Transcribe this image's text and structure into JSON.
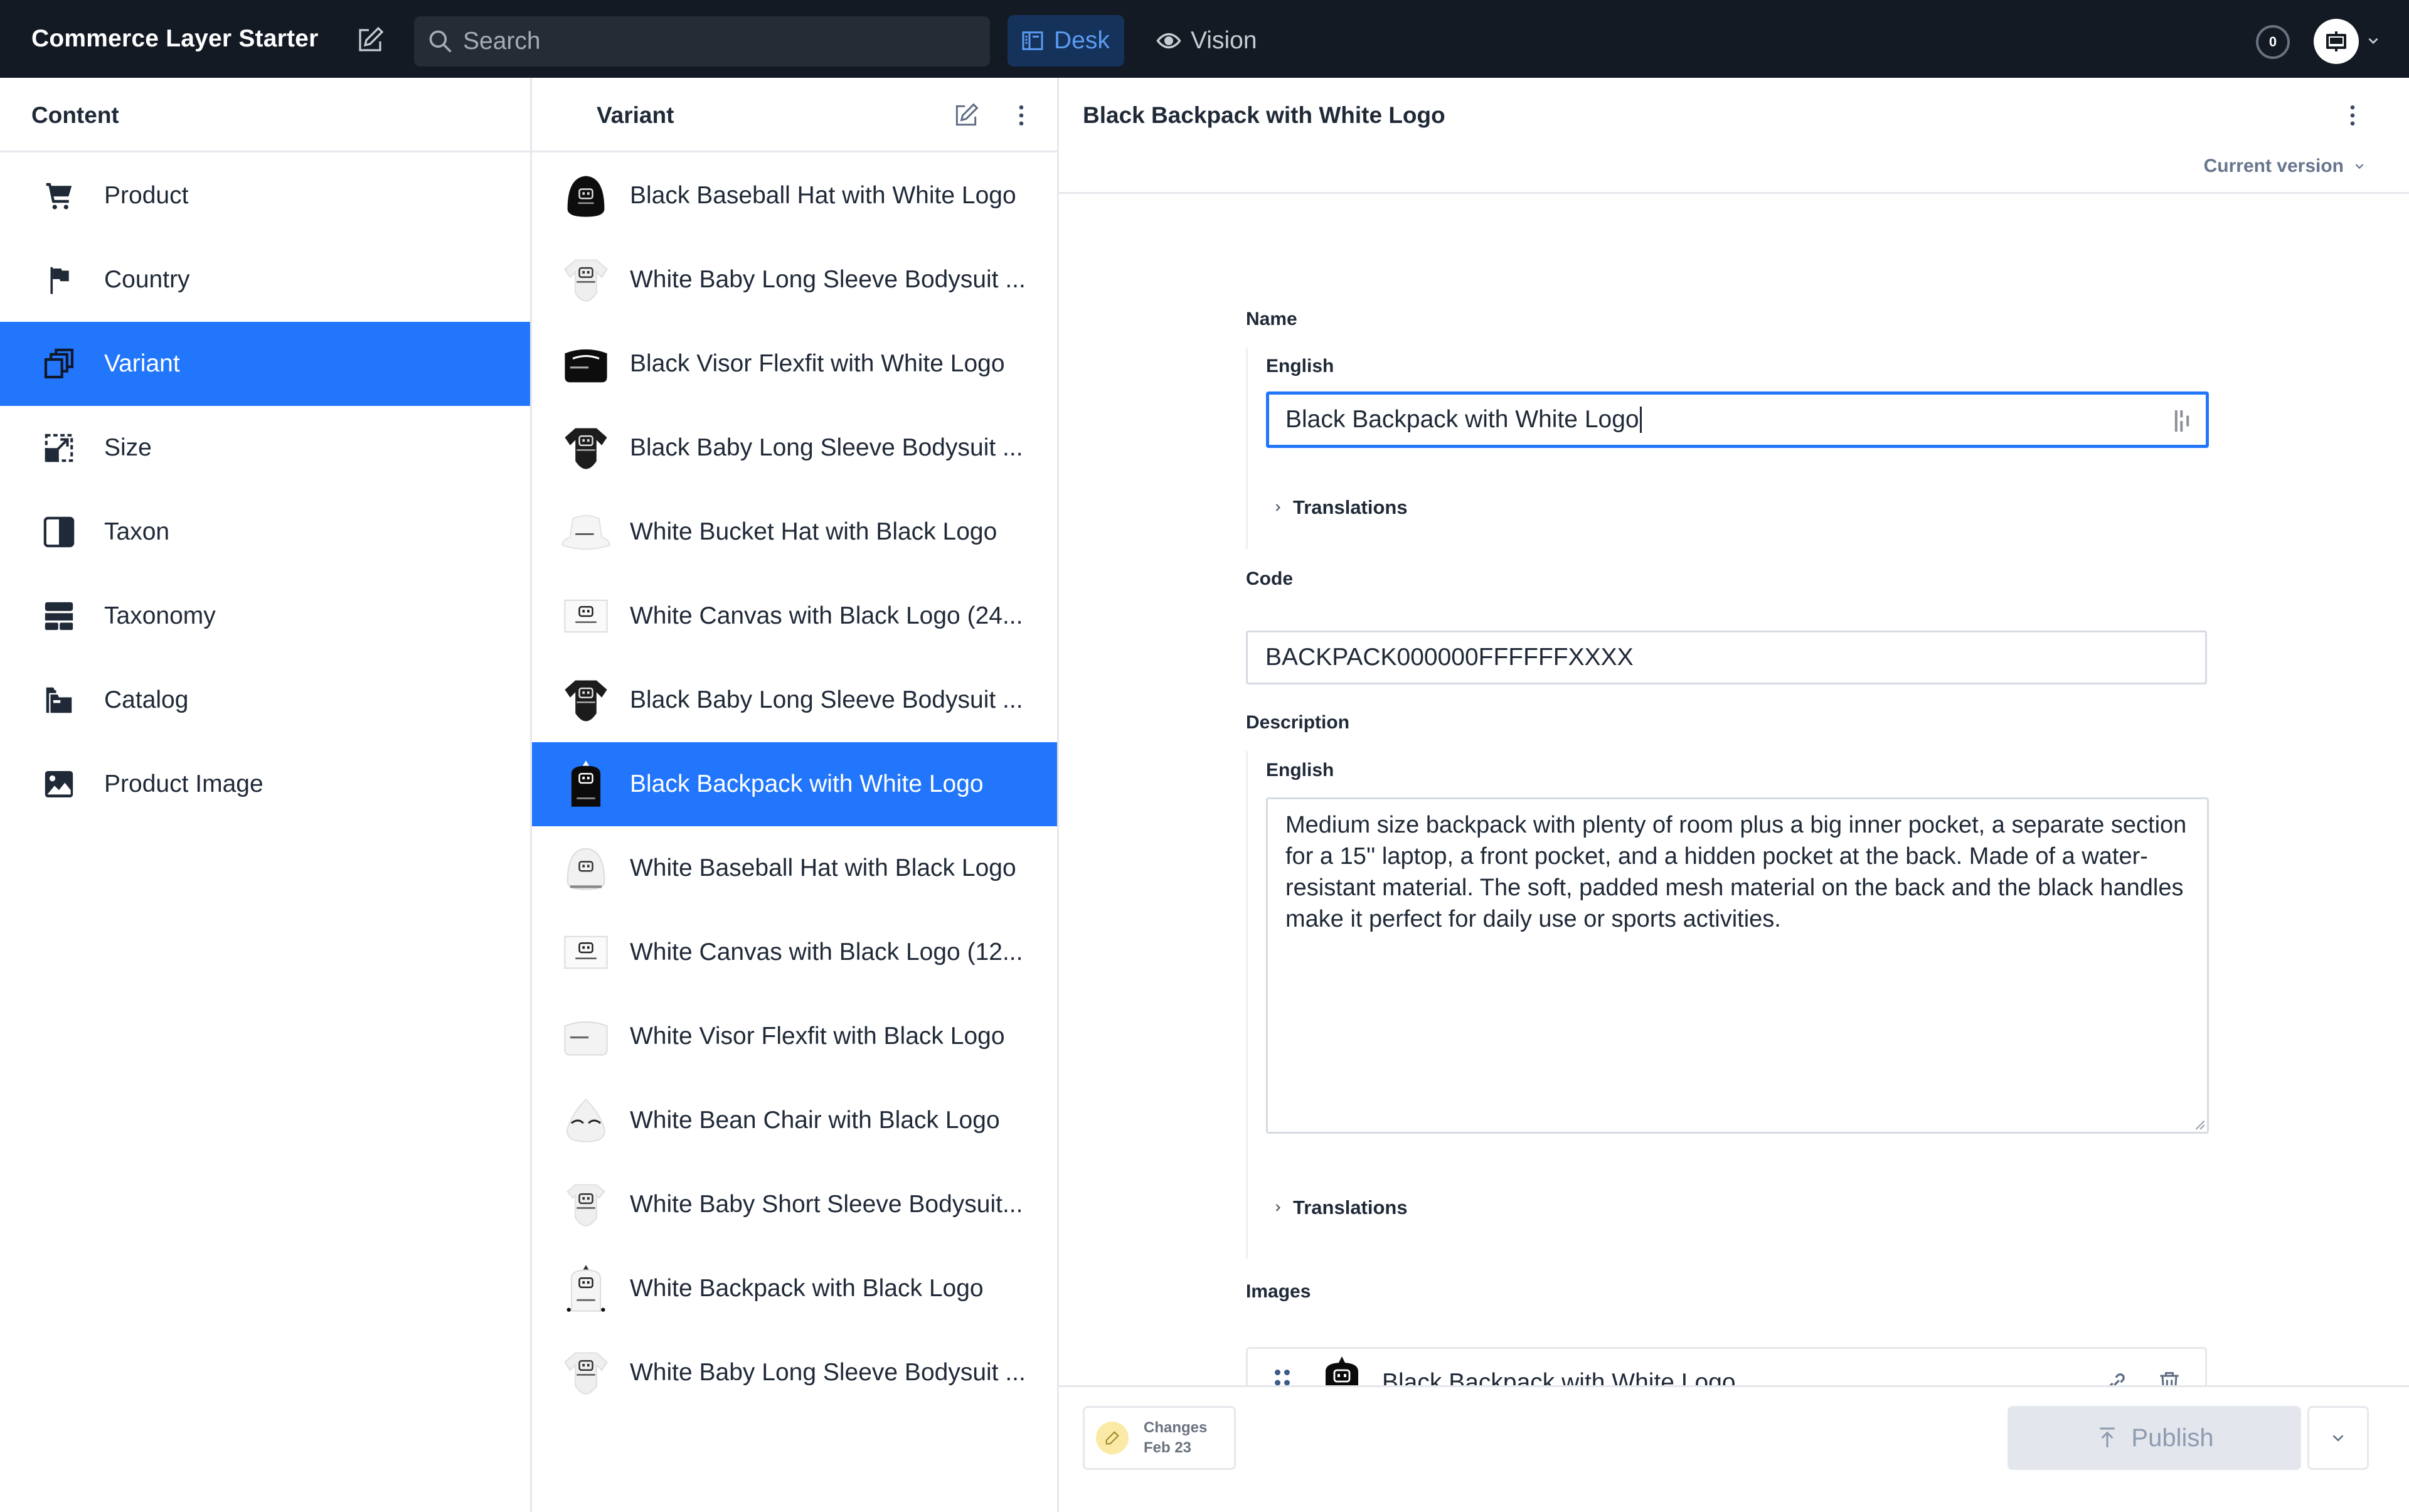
{
  "topbar": {
    "brand": "Commerce Layer Starter",
    "search_placeholder": "Search",
    "tools": [
      {
        "label": "Desk",
        "icon": "desk-icon",
        "active": true
      },
      {
        "label": "Vision",
        "icon": "eye-icon",
        "active": false
      }
    ],
    "presence_count": "0",
    "colors": {
      "bar": "#131a24",
      "active_tool_bg": "#15325a",
      "active_tool_text": "#5b9bf2"
    }
  },
  "content_pane": {
    "title": "Content",
    "items": [
      {
        "label": "Product",
        "icon": "cart-icon",
        "active": false
      },
      {
        "label": "Country",
        "icon": "flag-icon",
        "active": false
      },
      {
        "label": "Variant",
        "icon": "copy-icon",
        "active": true
      },
      {
        "label": "Size",
        "icon": "resize-icon",
        "active": false
      },
      {
        "label": "Taxon",
        "icon": "split-square-icon",
        "active": false
      },
      {
        "label": "Taxonomy",
        "icon": "layout-icon",
        "active": false
      },
      {
        "label": "Catalog",
        "icon": "folders-icon",
        "active": false
      },
      {
        "label": "Product Image",
        "icon": "image-icon",
        "active": false
      }
    ]
  },
  "variant_pane": {
    "title": "Variant",
    "items": [
      {
        "label": "Black Baseball Hat with White Logo",
        "thumb": "black-hat",
        "active": false
      },
      {
        "label": "White Baby Long Sleeve Bodysuit ...",
        "thumb": "white-bodysuit",
        "active": false
      },
      {
        "label": "Black Visor Flexfit with White Logo",
        "thumb": "black-visor",
        "active": false
      },
      {
        "label": "Black Baby Long Sleeve Bodysuit ...",
        "thumb": "black-bodysuit",
        "active": false
      },
      {
        "label": "White Bucket Hat with Black Logo",
        "thumb": "white-bucket-hat",
        "active": false
      },
      {
        "label": "White Canvas with Black Logo (24...",
        "thumb": "white-canvas",
        "active": false
      },
      {
        "label": "Black Baby Long Sleeve Bodysuit ...",
        "thumb": "black-bodysuit",
        "active": false
      },
      {
        "label": "Black Backpack with White Logo",
        "thumb": "black-backpack",
        "active": true
      },
      {
        "label": "White Baseball Hat with Black Logo",
        "thumb": "white-hat",
        "active": false
      },
      {
        "label": "White Canvas with Black Logo (12...",
        "thumb": "white-canvas",
        "active": false
      },
      {
        "label": "White Visor Flexfit with Black Logo",
        "thumb": "white-visor",
        "active": false
      },
      {
        "label": "White Bean Chair with Black Logo",
        "thumb": "white-bean-chair",
        "active": false
      },
      {
        "label": "White Baby Short Sleeve Bodysuit...",
        "thumb": "white-bodysuit-short",
        "active": false
      },
      {
        "label": "White Backpack with Black Logo",
        "thumb": "white-backpack",
        "active": false
      },
      {
        "label": "White Baby Long Sleeve Bodysuit ...",
        "thumb": "white-bodysuit",
        "active": false
      }
    ],
    "colors": {
      "active_bg": "#2276fc"
    }
  },
  "document": {
    "title": "Black Backpack with White Logo",
    "version_label": "Current version",
    "fields": {
      "name": {
        "label": "Name",
        "lang_label": "English",
        "value": "Black Backpack with White Logo",
        "translations_label": "Translations"
      },
      "code": {
        "label": "Code",
        "value": "BACKPACK000000FFFFFFXXXX"
      },
      "description": {
        "label": "Description",
        "lang_label": "English",
        "value": "Medium size backpack with plenty of room plus a big inner pocket, a separate section for a 15'' laptop, a front pocket, and a hidden pocket at the back. Made of a water-resistant material. The soft, padded mesh material on the back and the black handles make it perfect for daily use or sports activities.",
        "translations_label": "Translations"
      },
      "images": {
        "label": "Images",
        "items": [
          {
            "name": "Black Backpack with White Logo",
            "thumb": "black-backpack"
          }
        ]
      }
    },
    "footer": {
      "changes_label": "Changes",
      "changes_date": "Feb 23",
      "publish_label": "Publish"
    }
  }
}
